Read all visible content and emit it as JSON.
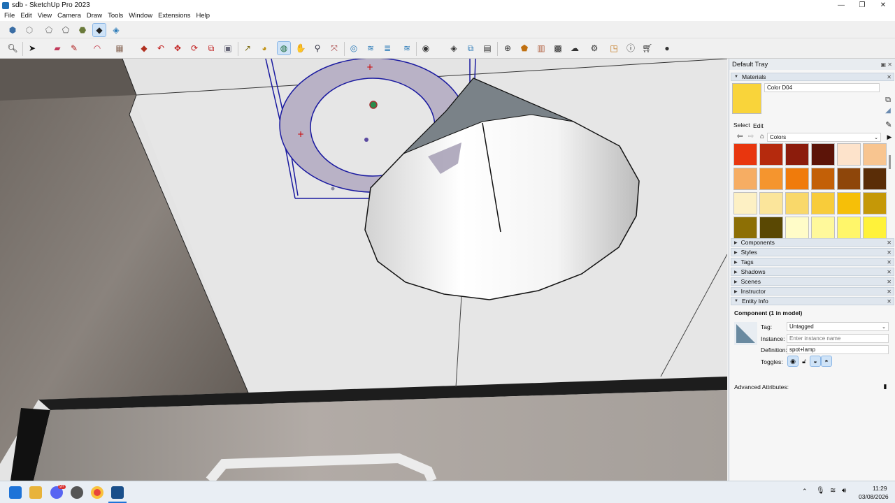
{
  "window": {
    "title": "sdb - SketchUp Pro 2023",
    "controls": [
      "—",
      "❐",
      "✕"
    ]
  },
  "menu": [
    "File",
    "Edit",
    "View",
    "Camera",
    "Draw",
    "Tools",
    "Window",
    "Extensions",
    "Help"
  ],
  "tray": {
    "title": "Default Tray",
    "materials": {
      "header": "Materials",
      "current_color": "#f9d43a",
      "current_name": "Color D04",
      "tab_select": "Select",
      "tab_edit": "Edit",
      "library": "Colors",
      "swatches": [
        "#e8360e",
        "#b52a0d",
        "#8c1c0c",
        "#5c1408",
        "#fde3cb",
        "#f8c590",
        "#f6ad63",
        "#f5952e",
        "#f07b0b",
        "#c36007",
        "#8e460a",
        "#5a2d07",
        "#fdf0c4",
        "#fbe59b",
        "#f9d86a",
        "#f8cc3a",
        "#f6bf08",
        "#c59807",
        "#8d6f05",
        "#5a4803",
        "#fffcc8",
        "#fff99b",
        "#fff66a",
        "#fff23a"
      ]
    },
    "panels": [
      "Components",
      "Styles",
      "Tags",
      "Shadows",
      "Scenes",
      "Instructor"
    ],
    "entity_info": {
      "header": "Entity Info",
      "summary": "Component (1 in model)",
      "tag_label": "Tag:",
      "tag_value": "Untagged",
      "instance_label": "Instance:",
      "instance_placeholder": "Enter instance name",
      "definition_label": "Definition:",
      "definition_value": "spot+lamp",
      "toggles_label": "Toggles:",
      "advanced_label": "Advanced Attributes:"
    }
  },
  "taskbar": {
    "time": "11:29",
    "date": "03/08/2026",
    "discord_badge": "9+"
  }
}
